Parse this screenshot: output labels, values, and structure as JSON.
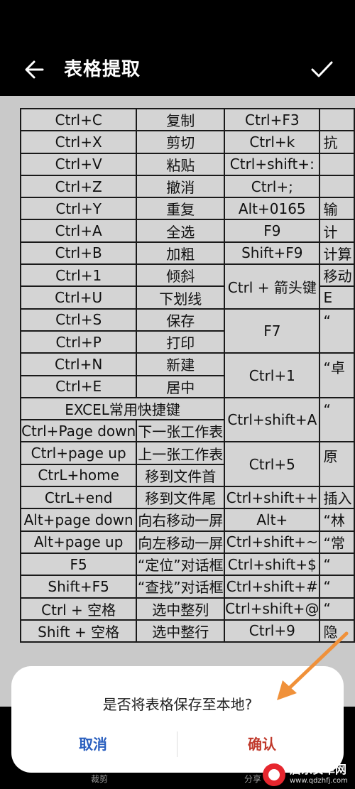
{
  "header": {
    "title": "表格提取"
  },
  "table": {
    "rows": [
      [
        "Ctrl+C",
        "复制",
        "Ctrl+F3",
        ""
      ],
      [
        "Ctrl+X",
        "剪切",
        "Ctrl+k",
        "抗"
      ],
      [
        "Ctrl+V",
        "粘贴",
        "Ctrl+shift+:",
        ""
      ],
      [
        "Ctrl+Z",
        "撤消",
        "Ctrl+;",
        ""
      ],
      [
        "Ctrl+Y",
        "重复",
        "Alt+0165",
        "输"
      ],
      [
        "Ctrl+A",
        "全选",
        "F9",
        "计"
      ],
      [
        "Ctrl+B",
        "加粗",
        "Shift+F9",
        "计算"
      ],
      [
        "Ctrl+1",
        "倾斜",
        "Ctrl + 箭头键",
        "移动"
      ],
      [
        "Ctrl+U",
        "下划线",
        "",
        "E"
      ],
      [
        "Ctrl+S",
        "保存",
        "F7",
        "“"
      ],
      [
        "Ctrl+P",
        "打印",
        "",
        ""
      ],
      [
        "Ctrl+N",
        "新建",
        "Ctrl+1",
        "“卓"
      ],
      [
        "Ctrl+E",
        "居中",
        "",
        ""
      ],
      [
        "EXCEL常用快捷键",
        "",
        "Ctrl+shift+A",
        "“"
      ],
      [
        "Ctrl+Page down",
        "下一张工作表",
        "",
        ""
      ],
      [
        "Ctrl+page up",
        "上一张工作表",
        "Ctrl+5",
        "原"
      ],
      [
        "CtrL+home",
        "移到文件首",
        "",
        ""
      ],
      [
        "CtrL+end",
        "移到文件尾",
        "Ctrl+shift++",
        "插入"
      ],
      [
        "Alt+page down",
        "向右移动一屏",
        "Alt+",
        "“林"
      ],
      [
        "Alt+page up",
        "向左移动一屏",
        "Ctrl+shift+~",
        "“常"
      ],
      [
        "F5",
        "“定位”对话框",
        "Ctrl+shift+$",
        "“"
      ],
      [
        "Shift+F5",
        "“查找”对话框",
        "Ctrl+shift+#",
        "“"
      ],
      [
        "Ctrl + 空格",
        "选中整列",
        "Ctrl+shift+@",
        "“"
      ],
      [
        "Shift + 空格",
        "选中整行",
        "Ctrl+9",
        "隐"
      ]
    ]
  },
  "dialog": {
    "message": "是否将表格保存至本地?",
    "cancel": "取消",
    "confirm": "确认"
  },
  "bottom_bar": {
    "left_label": "裁剪",
    "right_label": "分享"
  },
  "watermark": {
    "name": "启东安卓网",
    "url": "www.qdzhfj.com"
  },
  "colors": {
    "cancel": "#2a5fbf",
    "confirm": "#c0392b",
    "arrow": "#f0913a"
  }
}
